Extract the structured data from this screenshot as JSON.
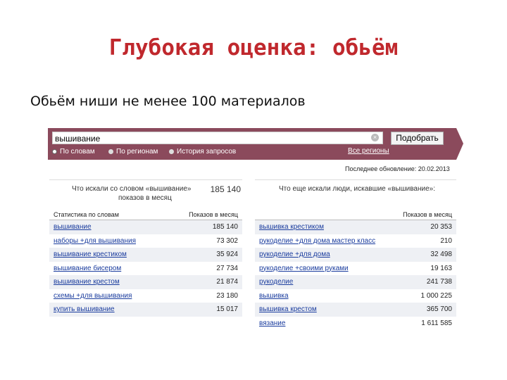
{
  "slide": {
    "title": "Глубокая оценка: обьём",
    "subtitle": "Обьём ниши не менее 100 материалов"
  },
  "search": {
    "query": "вышивание",
    "button_label": "Подобрать",
    "radio_words": "По словам",
    "radio_regions": "По регионам",
    "radio_history": "История запросов",
    "all_regions": "Все регионы",
    "updated": "Последнее обновление: 20.02.2013"
  },
  "left_table": {
    "heading": "Что искали со словом «вышивание»",
    "heading2": "показов в месяц",
    "total": "185 140",
    "col_keyword": "Статистика по словам",
    "col_count": "Показов в месяц",
    "rows": [
      {
        "kw": "вышивание",
        "n": "185 140"
      },
      {
        "kw": "наборы +для вышивания",
        "n": "73 302"
      },
      {
        "kw": "вышивание крестиком",
        "n": "35 924"
      },
      {
        "kw": "вышивание бисером",
        "n": "27 734"
      },
      {
        "kw": "вышивание крестом",
        "n": "21 874"
      },
      {
        "kw": "схемы +для вышивания",
        "n": "23 180"
      },
      {
        "kw": "купить вышивание",
        "n": "15 017"
      }
    ]
  },
  "right_table": {
    "heading": "Что еще искали люди, искавшие «вышивание»:",
    "col_keyword": "",
    "col_count": "Показов в месяц",
    "rows": [
      {
        "kw": "вышивка крестиком",
        "n": "20 353"
      },
      {
        "kw": "рукоделие +для дома мастер класс",
        "n": "210"
      },
      {
        "kw": "рукоделие +для дома",
        "n": "32 498"
      },
      {
        "kw": "рукоделие +своими руками",
        "n": "19 163"
      },
      {
        "kw": "рукоделие",
        "n": "241 738"
      },
      {
        "kw": "вышивка",
        "n": "1 000 225"
      },
      {
        "kw": "вышивка крестом",
        "n": "365 700"
      },
      {
        "kw": "вязание",
        "n": "1 611 585"
      }
    ]
  }
}
